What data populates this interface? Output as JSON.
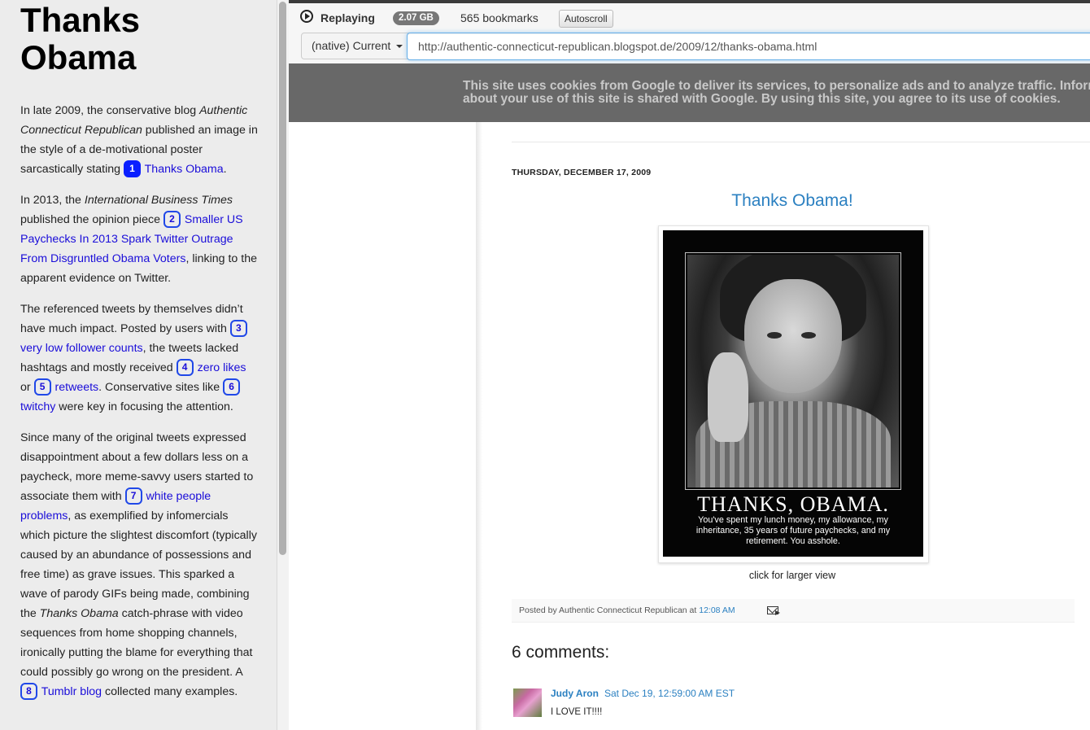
{
  "narrative": {
    "title": "Thanks Obama",
    "p1": {
      "text_a": "In late 2009, the conservative blog ",
      "blog_name": "Authentic Connecticut Republican",
      "text_b": " published an image in the style of a de-motivational poster sarcastically stating ",
      "bookmark_num": "1",
      "link": "Thanks Obama",
      "text_c": "."
    },
    "p2": {
      "text_a": "In 2013, the ",
      "publication": "International Business Times",
      "text_b": " published the opinion piece ",
      "bookmark_num": "2",
      "link": "Smaller US Paychecks In 2013 Spark Twitter Outrage From Disgruntled Obama Voters",
      "text_c": ", linking to the apparent evidence on Twitter."
    },
    "p3": {
      "text_a": "The referenced tweets by themselves didn’t have much impact. Posted by users with ",
      "num3": "3",
      "link3": "very low follower counts",
      "text_b": ", the tweets lacked hashtags and mostly received ",
      "num4": "4",
      "link4": "zero likes",
      "text_c": " or ",
      "num5": "5",
      "link5": "retweets",
      "text_d": ". Conservative sites like ",
      "num6": "6",
      "link6": "twitchy",
      "text_e": " were key in focusing the attention."
    },
    "p4": {
      "text_a": "Since many of the original tweets expressed disappointment about a few dollars less on a paycheck, more meme-savvy users started to associate them with ",
      "num7": "7",
      "link7": "white people problems",
      "text_b": ", as exemplified by infomercials which picture the slightest discomfort (typically caused by an abundance of possessions and free time) as grave issues. This sparked a wave of parody GIFs being made, combining the ",
      "phrase": "Thanks Obama",
      "text_c": " catch-phrase with video sequences from home shopping channels, ironically putting the blame for everything that could possibly go wrong on the president. A ",
      "num8": "8",
      "link8": "Tumblr blog",
      "text_d": " collected many examples."
    }
  },
  "toolbar": {
    "status": "Replaying",
    "size_badge": "2.07 GB",
    "bookmarks": "565 bookmarks",
    "autoscroll_label": "Autoscroll",
    "timestamp_select": "(native) Current",
    "url": "http://authentic-connecticut-republican.blogspot.de/2009/12/thanks-obama.html"
  },
  "blog": {
    "cookie_notice_line1": "This site uses cookies from Google to deliver its services, to personalize ads and to analyze traffic. Informatio",
    "cookie_notice_line2": "about your use of this site is shared with Google. By using this site, you agree to its use of cookies.",
    "date_header": "THURSDAY, DECEMBER 17, 2009",
    "post_title": "Thanks Obama!",
    "poster_title": "THANKS, OBAMA.",
    "poster_body": "You've spent my lunch money, my allowance, my inheritance, 35 years of future paychecks, and my retirement. You asshole.",
    "image_caption": "click for larger view",
    "posted_by": "Posted by Authentic Connecticut Republican at ",
    "posted_time": "12:08 AM",
    "comments_heading": "6 comments:",
    "comment": {
      "author": "Judy Aron",
      "date": "Sat Dec 19, 12:59:00 AM EST",
      "text": "I LOVE IT!!!!"
    }
  },
  "colors": {
    "link": "#1a0dd9",
    "active_bookmark": "#0a1fff",
    "blog_link": "#2b80c1",
    "cookie_bar": "#686868"
  }
}
